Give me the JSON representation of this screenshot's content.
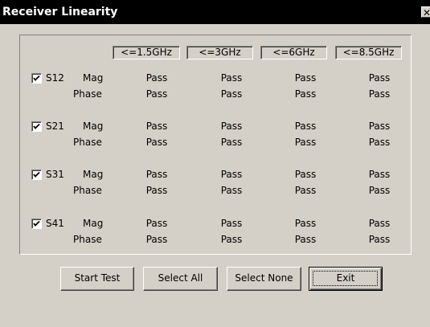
{
  "window": {
    "title": "Receiver Linearity",
    "close_glyph": "✕"
  },
  "headers": [
    "<=1.5GHz",
    "<=3GHz",
    "<=6GHz",
    "<=8.5GHz"
  ],
  "rows": [
    {
      "param": "S12",
      "checked": true,
      "mag_label": "Mag",
      "phase_label": "Phase",
      "mag": [
        "Pass",
        "Pass",
        "Pass",
        "Pass"
      ],
      "phase": [
        "Pass",
        "Pass",
        "Pass",
        "Pass"
      ]
    },
    {
      "param": "S21",
      "checked": true,
      "mag_label": "Mag",
      "phase_label": "Phase",
      "mag": [
        "Pass",
        "Pass",
        "Pass",
        "Pass"
      ],
      "phase": [
        "Pass",
        "Pass",
        "Pass",
        "Pass"
      ]
    },
    {
      "param": "S31",
      "checked": true,
      "mag_label": "Mag",
      "phase_label": "Phase",
      "mag": [
        "Pass",
        "Pass",
        "Pass",
        "Pass"
      ],
      "phase": [
        "Pass",
        "Pass",
        "Pass",
        "Pass"
      ]
    },
    {
      "param": "S41",
      "checked": true,
      "mag_label": "Mag",
      "phase_label": "Phase",
      "mag": [
        "Pass",
        "Pass",
        "Pass",
        "Pass"
      ],
      "phase": [
        "Pass",
        "Pass",
        "Pass",
        "Pass"
      ]
    }
  ],
  "buttons": {
    "start_test": "Start Test",
    "select_all": "Select All",
    "select_none": "Select None",
    "exit": "Exit"
  },
  "colors": {
    "dialog_bg": "#d4d0c8",
    "titlebar_bg": "#000000",
    "titlebar_text": "#ffffff"
  },
  "icons": {
    "check": "checkmark-icon",
    "close": "close-icon"
  }
}
